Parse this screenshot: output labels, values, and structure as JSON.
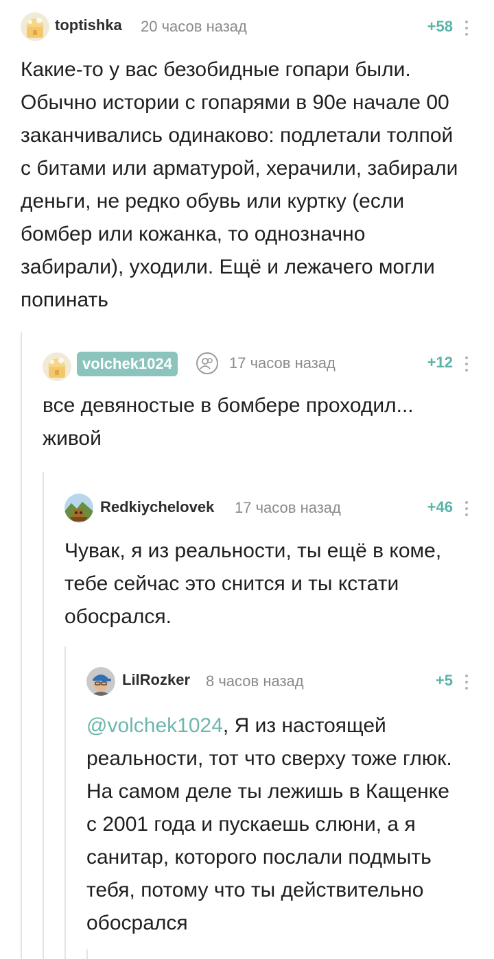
{
  "comments": [
    {
      "author": "toptishka",
      "time": "20 часов назад",
      "rating": "+58",
      "avatar": "default-avatar-icon",
      "text": "Какие-то у вас безобидные гопари были. Обычно истории с гопарями в 90е начале 00 заканчивались одинаково: подлетали толпой с битами или арматурой, херачили, забирали деньги, не редко обувь или куртку (если бомбер или кожанка, то однозначно забирали), уходили. Ещё и лежачего могли попинать"
    },
    {
      "author": "volchek1024",
      "time": "17 часов назад",
      "rating": "+12",
      "avatar": "default-avatar-icon",
      "badge": "users-icon",
      "text": "все девяностые в бомбере проходил... живой"
    },
    {
      "author": "Redkiychelovek",
      "time": "17 часов назад",
      "rating": "+46",
      "avatar": "landscape-avatar-icon",
      "text": "Чувак, я из реальности, ты ещё в коме, тебе сейчас это снится и ты кстати обосрался."
    },
    {
      "author": "LilRozker",
      "time": "8 часов назад",
      "rating": "+5",
      "avatar": "person-cap-avatar-icon",
      "mention": "@volchek1024",
      "text": ",  Я из настоящей реальности, тот что сверху тоже глюк. На самом деле ты лежишь в Кащенке с 2001 года и пускаешь слюни, а я санитар, которого послали подмыть тебя, потому что ты действительно обосрался"
    }
  ],
  "colors": {
    "accent": "#5ab3a8",
    "author_highlight_bg": "#8ac4bd",
    "meta_text": "#8a8a8a",
    "thread_line": "#e4e4e4"
  }
}
